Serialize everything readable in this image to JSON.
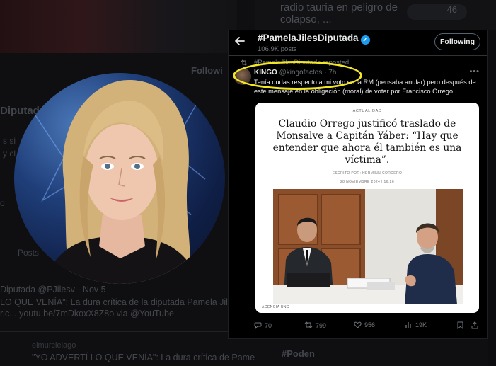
{
  "background": {
    "headline": "radio tauria en peligro de colapso, ...",
    "count": "46",
    "profile_name_fragment": "Diputad",
    "follow_fragment": "Followi",
    "bio_line1": "s si",
    "bio_line2": "y cl",
    "location_fragment": "o",
    "tab_fragment": "Posts",
    "post_author": "Diputada",
    "post_handle_fragment": "@PJilesv · Nov 5",
    "post_text1": "LO QUE VENÍA\": La dura crítica de la diputada Pamela Jiles",
    "post_text2": "ric... youtu.be/7mDkoxX8Z8o via @YouTube",
    "post_author2": "elmurcielago",
    "post_text3": "\"YO ADVERTÍ LO QUE VENÍA\": La dura crítica de Pame",
    "hashtag_fragment": "#Poden"
  },
  "header": {
    "title": "#PamelaJilesDiputada",
    "posts_count": "106.9K posts",
    "following_label": "Following"
  },
  "tweet": {
    "repost_text": "#PamelaJilesDiputada reposted",
    "author_name": "KINGO",
    "author_handle": "@kingofactos",
    "time": "· 7h",
    "text": "Tenía dudas respecto a mi voto en la RM (pensaba anular) pero después de este mensaje en la obligación (moral) de votar por Francisco Orrego.",
    "card": {
      "section": "ACTUALIDAD",
      "title": "Claudio Orrego justificó traslado de Monsalve a Capitán Yáber: “Hay que entender que ahora él también es una víctima”.",
      "byline": "ESCRITO POR: HERMINN CORDERO",
      "date": "28 NOVIEMBRE 2024 | 16:26",
      "caption": "AGENCIA UNO"
    },
    "stats": {
      "replies": "70",
      "reposts": "799",
      "likes": "956",
      "views": "19K"
    }
  },
  "colors": {
    "accent": "#1d9bf0",
    "highlight": "#f3e626",
    "panel_bg": "#000000",
    "muted": "#71767b"
  }
}
